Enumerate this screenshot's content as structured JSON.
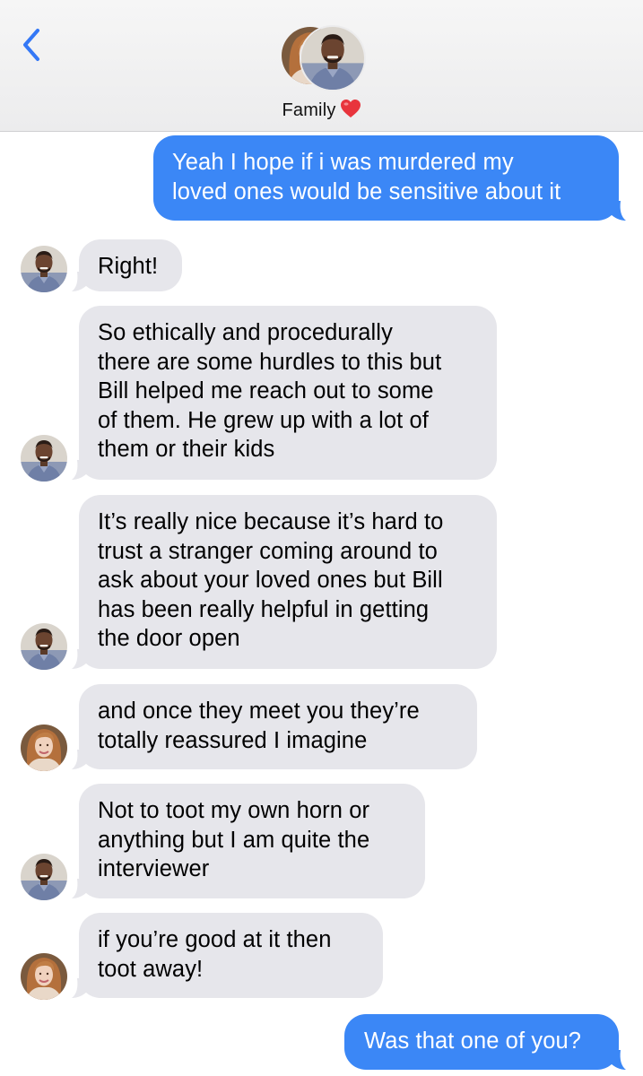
{
  "header": {
    "title": "Family",
    "title_emoji": "heart",
    "back_icon": "chevron-left-icon"
  },
  "colors": {
    "outgoing_bubble": "#3b87f6",
    "incoming_bubble": "#e6e6eb",
    "back_chevron": "#3478f6"
  },
  "messages": [
    {
      "id": "m1",
      "direction": "out",
      "sender": "me",
      "text": "Yeah I hope if i was murdered my\nloved ones would be sensitive about it"
    },
    {
      "id": "m2",
      "direction": "in",
      "sender": "man",
      "text": "Right!"
    },
    {
      "id": "m3",
      "direction": "in",
      "sender": "man",
      "text": "So ethically and procedurally\nthere are some hurdles to this but\nBill helped me reach out to some\nof them. He grew up with a lot of\nthem or their kids"
    },
    {
      "id": "m4",
      "direction": "in",
      "sender": "man",
      "text": "It’s really nice because it’s hard to\ntrust a stranger coming around to\nask about your loved ones but Bill\nhas been really helpful in getting\nthe door open"
    },
    {
      "id": "m5",
      "direction": "in",
      "sender": "woman",
      "text": "and once they meet you they’re\ntotally reassured I imagine"
    },
    {
      "id": "m6",
      "direction": "in",
      "sender": "man",
      "text": "Not to toot my own horn or\nanything but I am quite the\ninterviewer"
    },
    {
      "id": "m7",
      "direction": "in",
      "sender": "woman",
      "text": "if you’re good at it then\ntoot away!"
    },
    {
      "id": "m8",
      "direction": "out",
      "sender": "me",
      "text": "Was that one of you?"
    }
  ]
}
